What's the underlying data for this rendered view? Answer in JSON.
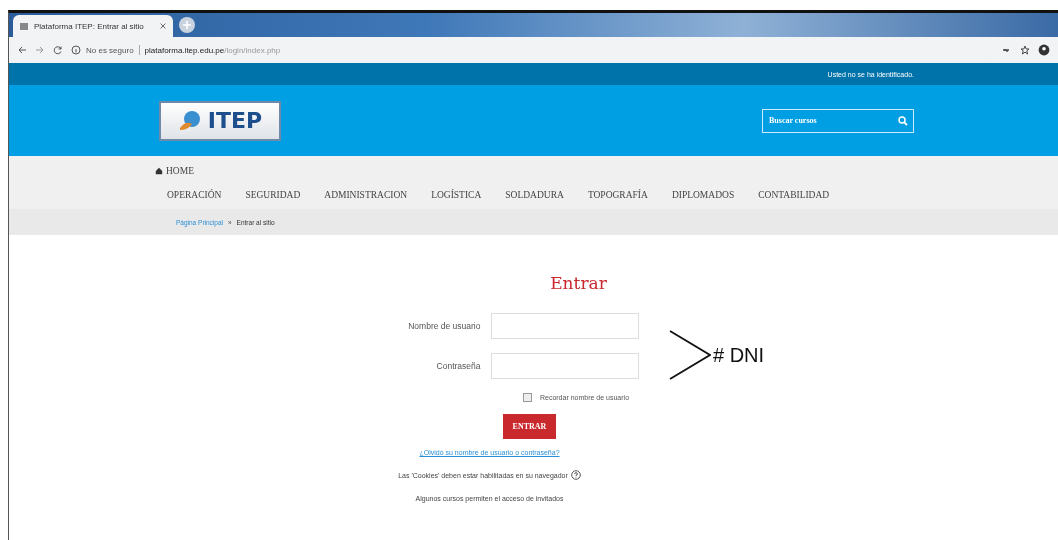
{
  "browser": {
    "tab_title": "Plataforma ITEP: Entrar al sitio",
    "security": "No es seguro",
    "url_host": "plataforma.itep.edu.pe",
    "url_path": "/login/index.php"
  },
  "top_bar": {
    "login_status": "Usted no se ha identificado."
  },
  "header": {
    "logo_text": "ITEP",
    "search": {
      "placeholder": "Buscar cursos"
    }
  },
  "nav": {
    "home": "HOME",
    "items": [
      "OPERACIÓN",
      "SEGURIDAD",
      "ADMINISTRACION",
      "LOGÍSTICA",
      "SOLDADURA",
      "TOPOGRAFÍA",
      "DIPLOMADOS",
      "CONTABILIDAD"
    ]
  },
  "breadcrumb": [
    {
      "label": "Página Principal",
      "kind": "link"
    },
    {
      "label": "»",
      "kind": "separator"
    },
    {
      "label": "Entrar al sitio",
      "kind": "current"
    }
  ],
  "login": {
    "title": "Entrar",
    "fields": [
      {
        "label": "Nombre de usuario"
      },
      {
        "label": "Contraseña"
      }
    ],
    "remember": {
      "label": "Recordar nombre de usuario",
      "checked": false
    },
    "submit": "ENTRAR",
    "forgot_link": "¿Olvidó su nombre de usuario o contraseña?",
    "cookies_note": "Las 'Cookies' deben estar habilitadas en su navegador",
    "guest_note": "Algunos cursos permiten el acceso de invitados"
  },
  "annotation": {
    "text": "# DNI"
  }
}
